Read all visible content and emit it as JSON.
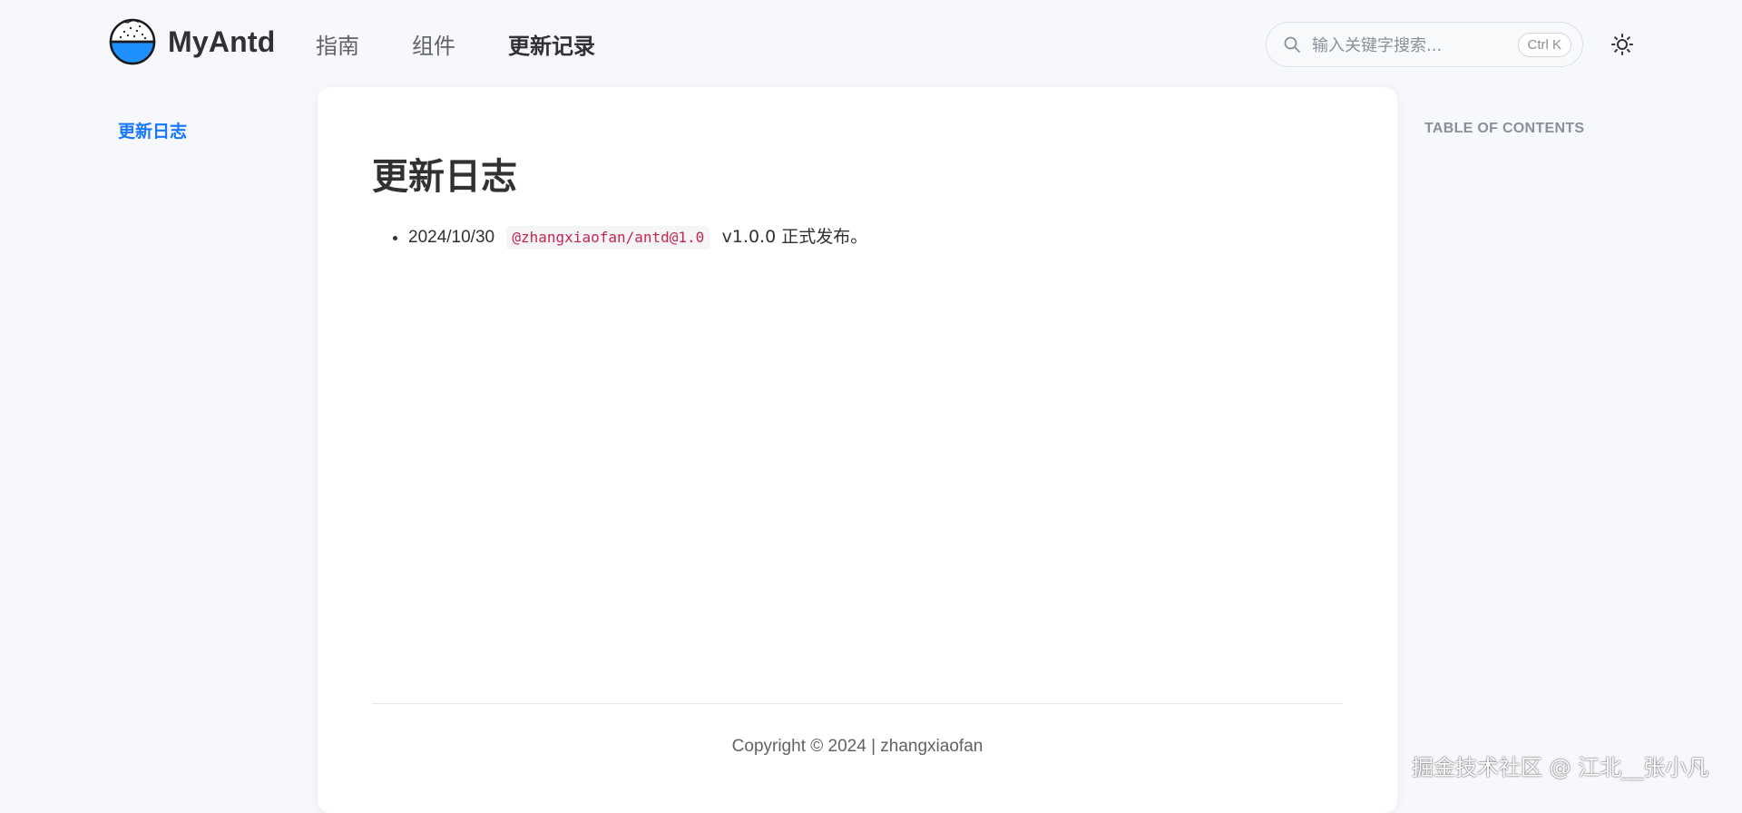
{
  "header": {
    "logo_text": "MyAntd",
    "nav": [
      {
        "label": "指南",
        "active": false
      },
      {
        "label": "组件",
        "active": false
      },
      {
        "label": "更新记录",
        "active": true
      }
    ],
    "search": {
      "placeholder": "输入关键字搜索...",
      "shortcut": "Ctrl K"
    }
  },
  "sidebar": {
    "items": [
      {
        "label": "更新日志",
        "active": true
      }
    ]
  },
  "main": {
    "title": "更新日志",
    "entries": [
      {
        "date": "2024/10/30",
        "package": "@zhangxiaofan/antd@1.0",
        "description": "v1.0.0 正式发布。"
      }
    ],
    "footer": "Copyright © 2024 | zhangxiaofan"
  },
  "toc": {
    "title": "TABLE OF CONTENTS"
  },
  "watermark": "掘金技术社区 @ 江北__张小凡",
  "colors": {
    "accent": "#1677ff",
    "background": "#f6f8fb",
    "code_text": "#c7254e"
  },
  "icons": [
    "logo-icon",
    "search-icon",
    "sun-icon"
  ]
}
